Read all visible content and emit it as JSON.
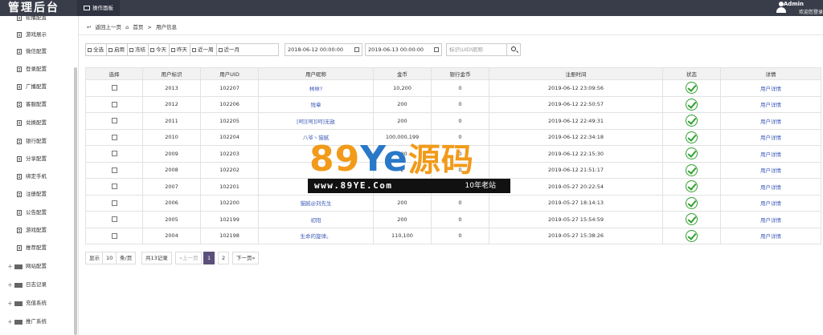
{
  "header": {
    "logo": "管理后台",
    "tab_label": "操作面板",
    "user_name": "Admin",
    "user_action": "欢迎您登录"
  },
  "sidebar": {
    "items": [
      {
        "label": "轮播配置"
      },
      {
        "label": "游戏展示"
      },
      {
        "label": "微信配置"
      },
      {
        "label": "登录配置"
      },
      {
        "label": "广播配置"
      },
      {
        "label": "客服配置"
      },
      {
        "label": "兑换配置"
      },
      {
        "label": "银行配置"
      },
      {
        "label": "分享配置"
      },
      {
        "label": "绑定手机"
      },
      {
        "label": "注册配置"
      },
      {
        "label": "公告配置"
      },
      {
        "label": "游戏配置"
      },
      {
        "label": "推荐配置"
      }
    ],
    "groups": [
      {
        "label": "网站配置"
      },
      {
        "label": "日志记录"
      },
      {
        "label": "充值系统"
      },
      {
        "label": "推广系统"
      }
    ]
  },
  "breadcrumb": {
    "back": "返回上一页",
    "home": "首页",
    "sep": ">",
    "current": "用户信息"
  },
  "toolbar": {
    "buttons": [
      "全选",
      "启用",
      "冻结",
      "今天",
      "昨天",
      "近一周",
      "近一月"
    ],
    "date_start": "2018-06-12 00:00:00",
    "date_end": "2019-06-13 00:00:00",
    "search_placeholder": "标识\\UID\\昵称"
  },
  "table": {
    "headers": [
      "选择",
      "用户标识",
      "用户UID",
      "用户昵称",
      "金币",
      "银行金币",
      "注册时间",
      "状态",
      "详情"
    ],
    "rows": [
      {
        "id": "2013",
        "uid": "102207",
        "nick": "林林?",
        "gold": "10,200",
        "bank": "0",
        "time": "2019-06-12 23:09:56",
        "detail": "用户详情"
      },
      {
        "id": "2012",
        "uid": "102206",
        "nick": "残章",
        "gold": "200",
        "bank": "0",
        "time": "2019-06-12 22:50:57",
        "detail": "用户详情"
      },
      {
        "id": "2011",
        "uid": "102205",
        "nick": "[呵][呵][呵]无敌",
        "gold": "200",
        "bank": "0",
        "time": "2019-06-12 22:49:31",
        "detail": "用户详情"
      },
      {
        "id": "2010",
        "uid": "102204",
        "nick": "八爷丶猫腻",
        "gold": "100,000,199",
        "bank": "0",
        "time": "2019-06-12 22:34:18",
        "detail": "用户详情"
      },
      {
        "id": "2009",
        "uid": "102203",
        "nick": "人",
        "gold": "200",
        "bank": "0",
        "time": "2019-06-12 22:15:30",
        "detail": "用户详情"
      },
      {
        "id": "2008",
        "uid": "102202",
        "nick": "",
        "gold": "2",
        "bank": "0",
        "time": "2019-06-12 21:51:17",
        "detail": "用户详情"
      },
      {
        "id": "2007",
        "uid": "102201",
        "nick": "",
        "gold": "",
        "bank": "0",
        "time": "2019-05-27 20:22:54",
        "detail": "用户详情"
      },
      {
        "id": "2006",
        "uid": "102200",
        "nick": "猫腻@刘先生",
        "gold": "200",
        "bank": "0",
        "time": "2019-05-27 18:14:13",
        "detail": "用户详情"
      },
      {
        "id": "2005",
        "uid": "102199",
        "nick": "初阳",
        "gold": "200",
        "bank": "0",
        "time": "2019-05-27 15:54:59",
        "detail": "用户详情"
      },
      {
        "id": "2004",
        "uid": "102198",
        "nick": "生命的旋律。",
        "gold": "110,100",
        "bank": "0",
        "time": "2019-05-27 15:38:26",
        "detail": "用户详情"
      }
    ]
  },
  "pager": {
    "show": "显示",
    "size": "10",
    "per_page": "条/页",
    "total": "共13记录",
    "prev": "«上一页",
    "page1": "1",
    "page2": "2",
    "next": "下一页»"
  },
  "watermark": {
    "big_89": "89",
    "big_ye": "Ye",
    "big_cn": "源码",
    "url": "www.89YE.Com",
    "tag": "10年老站"
  },
  "colors": {
    "topbar": "#393d49",
    "accent_page": "#5b4f7b",
    "link": "#3e5db8",
    "status_ok": "#2fa02f"
  }
}
